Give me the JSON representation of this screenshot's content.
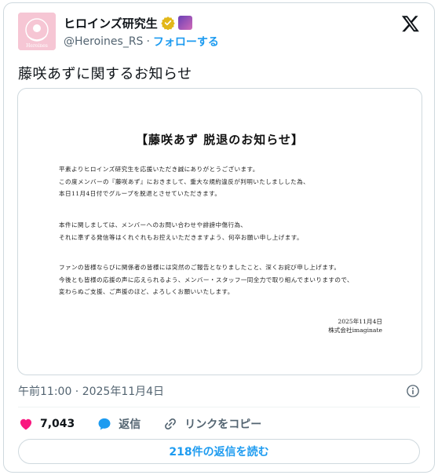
{
  "author": {
    "display_name": "ヒロインズ研究生",
    "handle": "@Heroines_RS",
    "separator": "·",
    "follow_label": "フォローする",
    "avatar_text": "Heroines",
    "verified_color": "#e2b719"
  },
  "post": {
    "text": "藤咲あずに関するお知らせ"
  },
  "document": {
    "title": "【藤咲あず 脱退のお知らせ】",
    "paragraph1": [
      "平素よりヒロインズ研究生を応援いただき誠にありがとうございます。",
      "この度メンバーの『藤咲あず』におきまして、重大な規約違反が判明いたしましした為、",
      "本日11月4日付でグループを脱退とさせていただきます。"
    ],
    "paragraph2": [
      "本件に関しましては、メンバーへのお問い合わせや誹謗中傷行為、",
      "それに準ずる発信等はくれぐれもお控えいただきますよう、何卒お願い申し上げます。"
    ],
    "paragraph3": [
      "ファンの皆様ならびに関係者の皆様には突然のご報告となりましたこと、深くお詫び申し上げます。",
      "今後とも皆様の応援の声に応えられるよう、メンバー・スタッフ一同全力で取り組んでまいりますので、",
      "変わらぬご支援、ご声援のほど、よろしくお願いいたします。"
    ],
    "date": "2025年11月4日",
    "company": "株式会社imaginate"
  },
  "meta": {
    "timestamp": "午前11:00 · 2025年11月4日"
  },
  "actions": {
    "like_count": "7,043",
    "reply_label": "返信",
    "copy_link_label": "リンクをコピー"
  },
  "footer": {
    "read_replies_label": "218件の返信を読む"
  },
  "colors": {
    "accent": "#1d9bf0",
    "like": "#f91880",
    "text": "#0f1419",
    "muted": "#536471"
  }
}
